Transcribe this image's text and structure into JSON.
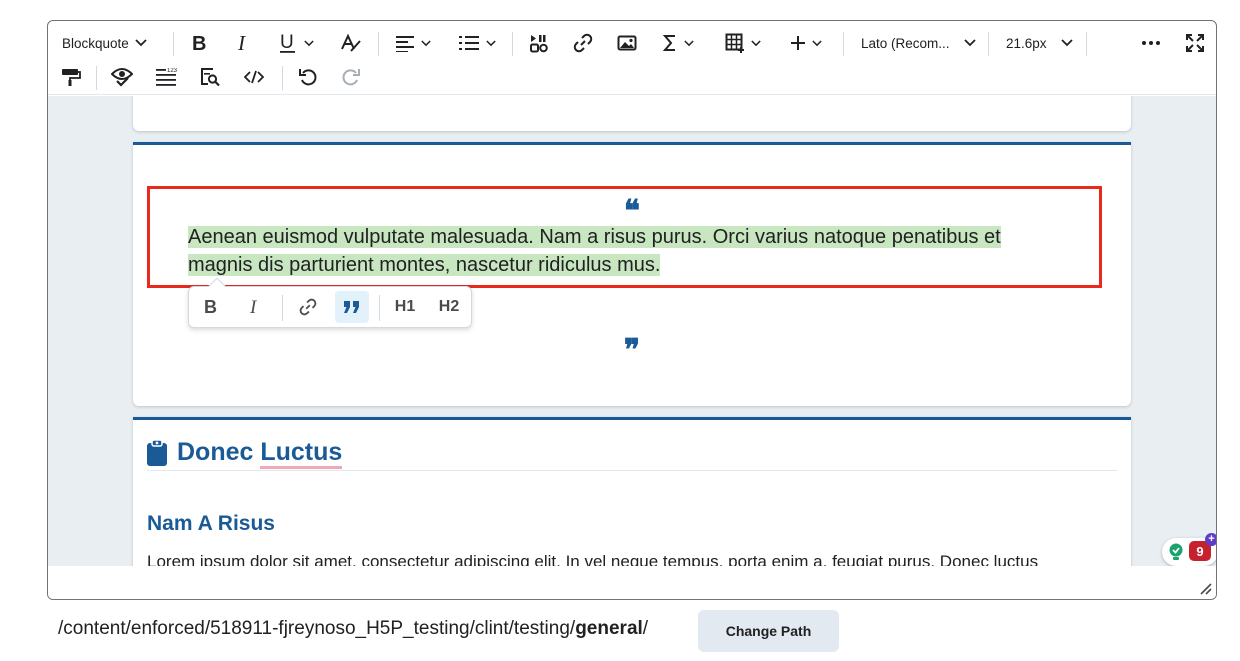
{
  "toolbar": {
    "block_format": "Blockquote",
    "font_family": "Lato (Recom...",
    "font_size": "21.6px"
  },
  "colors": {
    "accent": "#1a5a96",
    "highlight": "#c8e6c0",
    "selection_outline": "#e8291c",
    "spellcheck_underline": "#f4a7b6",
    "badge": "#c7202e"
  },
  "content": {
    "quote_text": "Aenean euismod vulputate malesuada. Nam a risus purus. Orci varius natoque penatibus et magnis dis parturient montes, nascetur ridiculus mus.",
    "section_title_a": "Donec ",
    "section_title_b": "Luctus",
    "subheading": "Nam A Risus",
    "paragraph": "Lorem ipsum dolor sit amet, consectetur adipiscing elit. In vel neque tempus, porta enim a, feugiat purus. Donec luctus"
  },
  "inline_toolbar": {
    "h1": "H1",
    "h2": "H2"
  },
  "assistant_badge": {
    "count": "9",
    "plus": "+"
  },
  "footer": {
    "path_prefix": "/content/enforced/518911-fjreynoso_H5P_testing/clint/testing/",
    "path_folder": "general",
    "path_suffix": "/",
    "change_path_label": "Change Path"
  }
}
